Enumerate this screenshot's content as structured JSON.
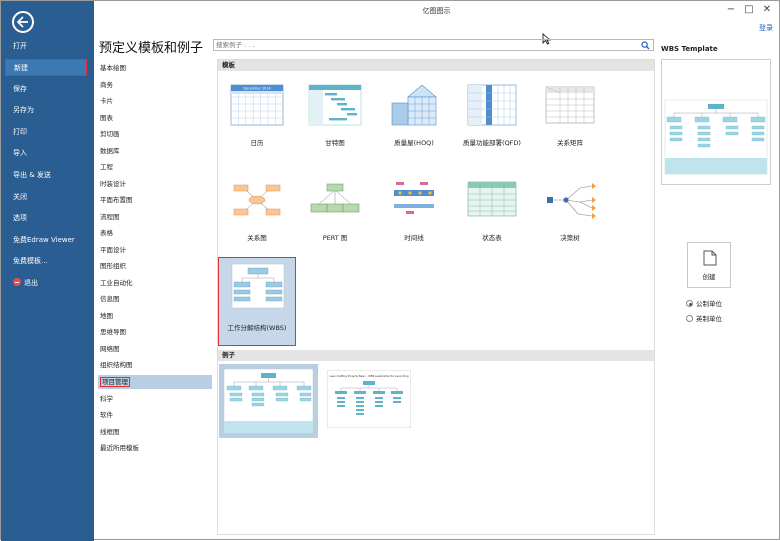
{
  "window": {
    "title": "亿图图示",
    "login_label": "登录",
    "minimize": "−",
    "maximize": "□",
    "close": "✕"
  },
  "sidebar": {
    "items": [
      "打开",
      "新建",
      "保存",
      "另存为",
      "打印",
      "导入",
      "导出 & 发送",
      "关闭",
      "选项",
      "免费Edraw Viewer",
      "免费模板...",
      "退出"
    ],
    "active_index": 1
  },
  "main": {
    "title": "预定义模板和例子",
    "search_placeholder": "搜索例子 . . ."
  },
  "categories": {
    "items": [
      "基本绘图",
      "商务",
      "卡片",
      "图表",
      "剪切画",
      "数据库",
      "工程",
      "时装设计",
      "平面布置图",
      "流程图",
      "表格",
      "平面设计",
      "图形组织",
      "工业自动化",
      "信息图",
      "地图",
      "思维导图",
      "网络图",
      "组织结构图",
      "项目管理",
      "科学",
      "软件",
      "线框图",
      "最近所用模板"
    ],
    "selected_index": 19
  },
  "templates": {
    "section_label": "模板",
    "items": [
      "日历",
      "甘特图",
      "质量屋(HOQ)",
      "质量功能部署(QFD)",
      "关系矩阵",
      "关系图",
      "PERT 图",
      "时间线",
      "状态表",
      "决策树",
      "工作分解结构(WBS)"
    ],
    "selected_index": 10,
    "calendar_header": "December 2014"
  },
  "examples": {
    "section_label": "例子",
    "second_title": "Lean Crafting Projects Basic - WBS Leadership Pro Launching"
  },
  "right_panel": {
    "title": "WBS Template",
    "create_label": "创建",
    "units": [
      "公制单位",
      "英制单位"
    ],
    "selected_unit": 0
  },
  "colors": {
    "sidebar": "#2a5d91",
    "accent": "#e03030",
    "teal": "#5fb3c8",
    "selection": "#b9cde3"
  }
}
